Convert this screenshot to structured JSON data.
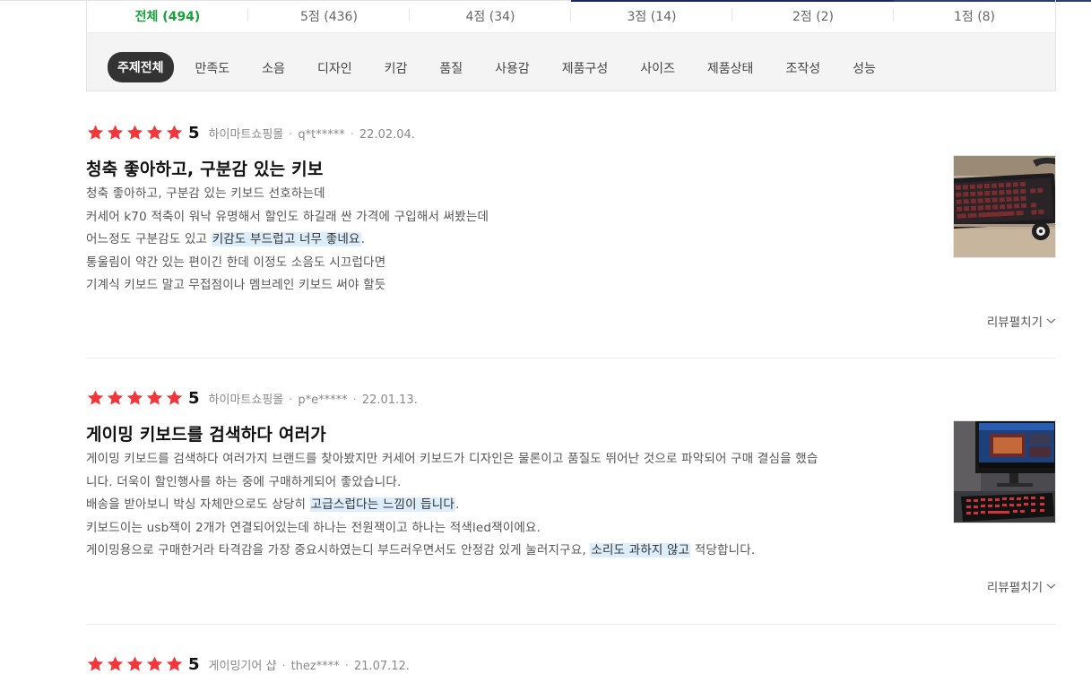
{
  "score_tabs": [
    {
      "label": "전체 (494)",
      "active": true
    },
    {
      "label": "5점 (436)",
      "active": false
    },
    {
      "label": "4점 (34)",
      "active": false
    },
    {
      "label": "3점 (14)",
      "active": false
    },
    {
      "label": "2점 (2)",
      "active": false
    },
    {
      "label": "1점 (8)",
      "active": false
    }
  ],
  "topics": [
    "주제전체",
    "만족도",
    "소음",
    "디자인",
    "키감",
    "품질",
    "사용감",
    "제품구성",
    "사이즈",
    "제품상태",
    "조작성",
    "성능"
  ],
  "active_topic": "주제전체",
  "colors": {
    "star": "#f2363a",
    "active_tab": "#16a33a",
    "highlight": "#dceefb",
    "chip_bg": "#333333"
  },
  "reviews": [
    {
      "rating": 5,
      "rating_label": "5",
      "shop": "하이마트쇼핑몰",
      "user": "q*t*****",
      "date": "22.02.04.",
      "title": "청축 좋아하고, 구분감 있는 키보",
      "lines": [
        [
          {
            "t": "청축 좋아하고, 구분감 있는 키보드 선호하는데"
          }
        ],
        [
          {
            "t": "커세어 k70 적축이 워낙 유명해서 할인도 하길래 싼 가격에 구입해서 써봤는데"
          }
        ],
        [
          {
            "t": "어느정도 구분감도 있고 "
          },
          {
            "t": "키감도 부드럽고 너무 좋네요",
            "hl": true
          },
          {
            "t": "."
          }
        ],
        [
          {
            "t": "통울림이 약간 있는 편이긴 한데 이정도 소음도 시끄럽다면"
          }
        ],
        [
          {
            "t": "기계식 키보드 말고 무접점이나 멤브레인 키보드 써야 할듯"
          }
        ]
      ],
      "expand_label": "리뷰펼치기",
      "thumb_icon": "keyboard-photo"
    },
    {
      "rating": 5,
      "rating_label": "5",
      "shop": "하이마트쇼핑몰",
      "user": "p*e*****",
      "date": "22.01.13.",
      "title": "게이밍 키보드를 검색하다 여러가",
      "lines": [
        [
          {
            "t": "게이밍 키보드를 검색하다 여러가지 브랜드를 찾아봤지만 커세어 키보드가 디자인은 물론이고 품질도 뛰어난 것으로 파악되어 구매 결심을 했습"
          }
        ],
        [
          {
            "t": "니다. 더욱이 할인행사를 하는 중에 구매하게되어 좋았습니다."
          }
        ],
        [
          {
            "t": "배송을 받아보니 박싱 자체만으로도 상당히 "
          },
          {
            "t": "고급스럽다는 느낌이 듭니다",
            "hl": true
          },
          {
            "t": "."
          }
        ],
        [
          {
            "t": "키보드이는 usb잭이 2개가 연결되어있는데 하나는 전원잭이고 하나는 적색led잭이에요."
          }
        ],
        [
          {
            "t": "게이밍용으로 구매한거라 타격감을 가장 중요시하였는디 부드러우면서도 안정감 있게 눌러지구요, "
          },
          {
            "t": "소리도 과하지 않고",
            "hl": true
          },
          {
            "t": " 적당합니다."
          }
        ]
      ],
      "expand_label": "리뷰펼치기",
      "thumb_icon": "monitor-keyboard-photo"
    },
    {
      "rating": 5,
      "rating_label": "5",
      "shop": "게이밍기어 샵",
      "user": "thez****",
      "date": "21.07.12."
    }
  ]
}
